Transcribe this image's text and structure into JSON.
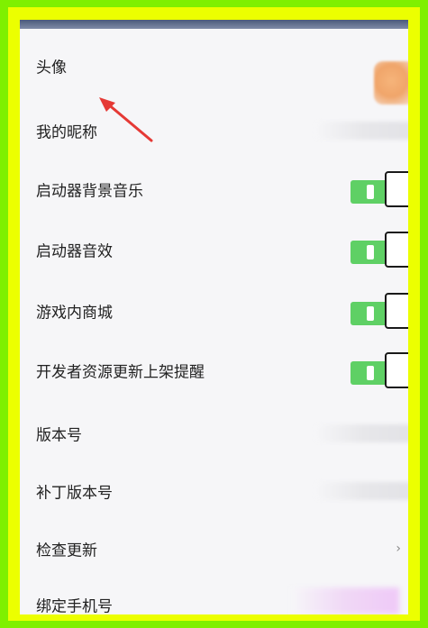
{
  "colors": {
    "outer_border": "#7ff000",
    "inner_border": "#ecff00",
    "toggle_on": "#5fd065",
    "arrow": "#e53935"
  },
  "settings": {
    "items": [
      {
        "label": "头像",
        "control": "avatar"
      },
      {
        "label": "我的昵称",
        "control": "value"
      },
      {
        "label": "启动器背景音乐",
        "control": "toggle",
        "on": true
      },
      {
        "label": "启动器音效",
        "control": "toggle",
        "on": true
      },
      {
        "label": "游戏内商城",
        "control": "toggle",
        "on": true
      },
      {
        "label": "开发者资源更新上架提醒",
        "control": "toggle",
        "on": true
      },
      {
        "label": "版本号",
        "control": "value"
      },
      {
        "label": "补丁版本号",
        "control": "value"
      },
      {
        "label": "检查更新",
        "control": "chevron"
      },
      {
        "label": "绑定手机号",
        "control": "value"
      }
    ]
  },
  "icons": {
    "avatar": "avatar-image",
    "arrow": "red-arrow-annotation",
    "chevron": "chevron-right-icon"
  }
}
